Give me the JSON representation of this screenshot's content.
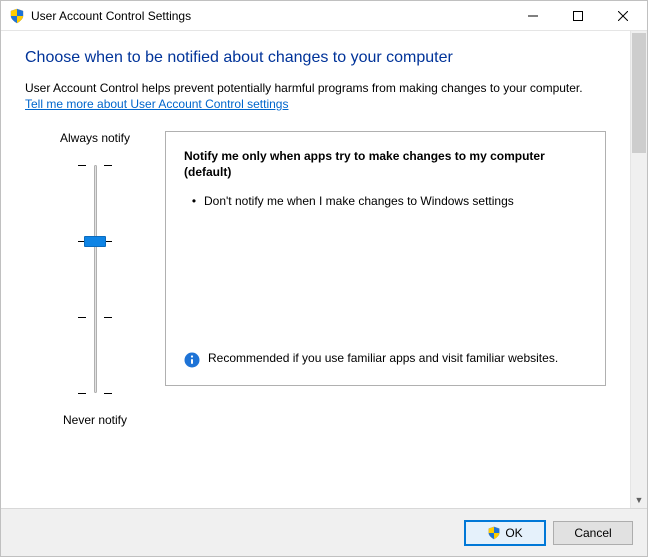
{
  "window": {
    "title": "User Account Control Settings"
  },
  "content": {
    "heading": "Choose when to be notified about changes to your computer",
    "description": "User Account Control helps prevent potentially harmful programs from making changes to your computer.",
    "help_link": "Tell me more about User Account Control settings"
  },
  "slider": {
    "top_label": "Always notify",
    "bottom_label": "Never notify",
    "levels": 4,
    "current_level": 2
  },
  "panel": {
    "title": "Notify me only when apps try to make changes to my computer (default)",
    "bullets": [
      "Don't notify me when I make changes to Windows settings"
    ],
    "note": "Recommended if you use familiar apps and visit familiar websites."
  },
  "buttons": {
    "ok": "OK",
    "cancel": "Cancel"
  }
}
